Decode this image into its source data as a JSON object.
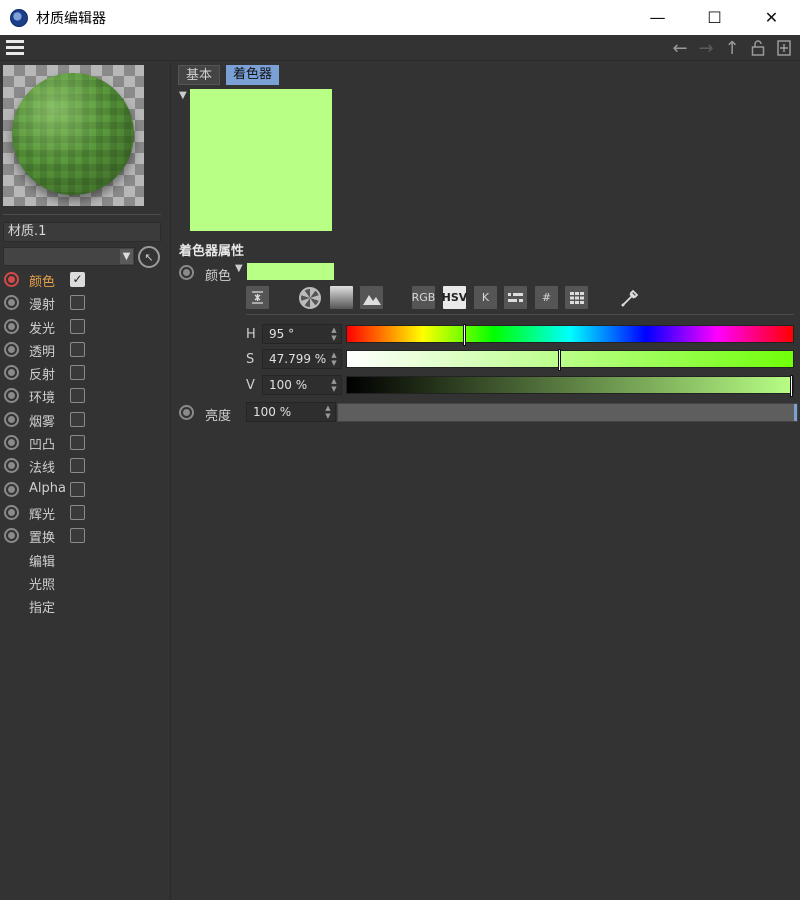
{
  "window": {
    "title": "材质编辑器",
    "min_glyph": "—",
    "max_glyph": "☐",
    "close_glyph": "✕"
  },
  "toolbar": {
    "icons": [
      "menu-icon",
      "arrow-left-icon",
      "arrow-right-icon",
      "arrow-up-icon",
      "lock-icon",
      "new-panel-icon"
    ]
  },
  "material": {
    "name": "材质.1",
    "preview": "green-sphere"
  },
  "channels": [
    {
      "label": "颜色",
      "checked": true,
      "active": true
    },
    {
      "label": "漫射",
      "checked": false
    },
    {
      "label": "发光",
      "checked": false
    },
    {
      "label": "透明",
      "checked": false
    },
    {
      "label": "反射",
      "checked": false
    },
    {
      "label": "环境",
      "checked": false
    },
    {
      "label": "烟雾",
      "checked": false
    },
    {
      "label": "凹凸",
      "checked": false
    },
    {
      "label": "法线",
      "checked": false
    },
    {
      "label": "Alpha",
      "checked": false
    },
    {
      "label": "辉光",
      "checked": false
    },
    {
      "label": "置换",
      "checked": false
    }
  ],
  "extras": [
    "编辑",
    "光照",
    "指定"
  ],
  "tabs": {
    "basic": "基本",
    "shader": "着色器"
  },
  "colors": {
    "swatch": "#b8ff85",
    "accent": "#7aa0d6",
    "active_channel": "#e8a14a"
  },
  "shader": {
    "section_title": "着色器属性",
    "color_label": "颜色",
    "modes": {
      "rgb": "RGB",
      "hsv": "HSV",
      "k": "K",
      "hash": "#"
    },
    "h": {
      "label": "H",
      "value": "95 °",
      "fraction": 0.2639
    },
    "s": {
      "label": "S",
      "value": "47.799 %",
      "fraction": 0.478
    },
    "v": {
      "label": "V",
      "value": "100 %",
      "fraction": 1.0
    },
    "brightness": {
      "label": "亮度",
      "value": "100 %"
    }
  }
}
